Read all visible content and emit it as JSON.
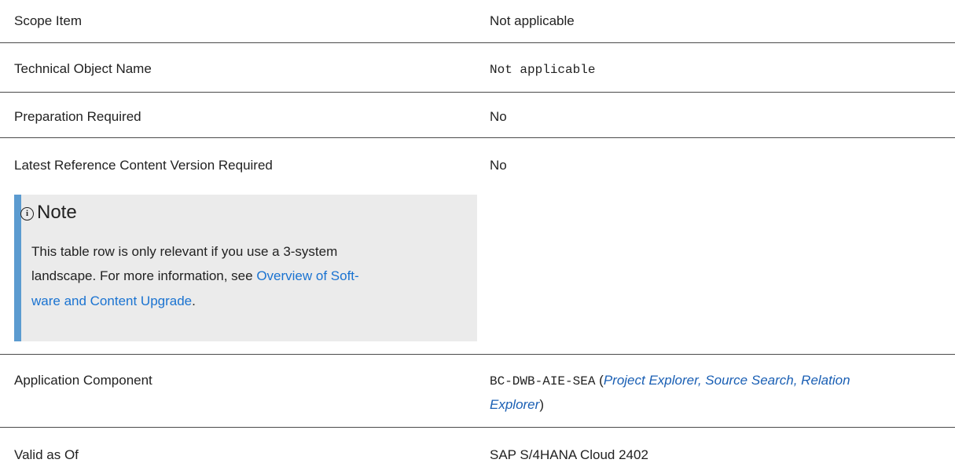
{
  "rows": [
    {
      "label": "Scope Item",
      "value": "Not applicable"
    },
    {
      "label": "Technical Object Name",
      "value": "Not applicable"
    },
    {
      "label": "Preparation Required",
      "value": "No"
    },
    {
      "label": "Latest Reference Content Version Required",
      "value": "No"
    },
    {
      "label": "Application Component",
      "value_code": "BC-DWB-AIE-SEA",
      "value_link_line1": "Project Explorer, Source Search, Relation",
      "value_link_line2": "Explorer",
      "open_paren": "(",
      "close_paren": ")"
    },
    {
      "label": "Valid as Of",
      "value": "SAP S/4HANA Cloud 2402"
    }
  ],
  "note": {
    "title": "Note",
    "icon": "info-icon",
    "line1": "This table row is only relevant if you use a 3-system",
    "line2_text": "landscape. For more information, see ",
    "line2_link": "Overview of Soft-",
    "line3_link": "ware and Content Upgrade",
    "line3_text": ".",
    "accent_color": "#5b9bd0",
    "background_color": "#ebebeb"
  }
}
